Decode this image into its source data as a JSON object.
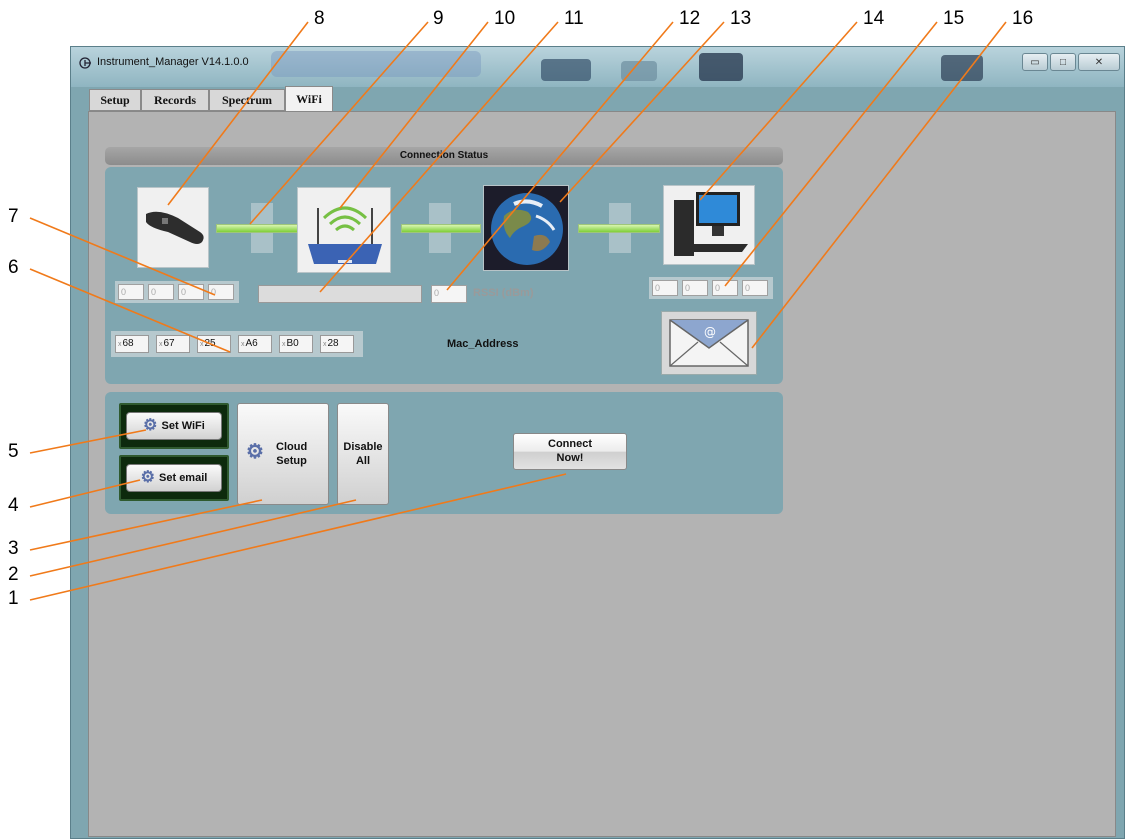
{
  "window": {
    "title": "Instrument_Manager V14.1.0.0",
    "controls": {
      "minimize": "▭",
      "maximize": "□",
      "close": "✕"
    }
  },
  "tabs": [
    {
      "label": "Setup"
    },
    {
      "label": "Records"
    },
    {
      "label": "Spectrum"
    },
    {
      "label": "WiFi",
      "active": true
    }
  ],
  "connection": {
    "header": "Connection Status",
    "instrument_ip": [
      "0",
      "0",
      "0",
      "0"
    ],
    "ssid": "",
    "rssi_value": "0",
    "rssi_label": "RSSI (dBm)",
    "pc_ip": [
      "0",
      "0",
      "0",
      "0"
    ],
    "mac_prefix": "x",
    "mac_address": [
      "68",
      "67",
      "25",
      "A6",
      "B0",
      "28"
    ],
    "mac_label": "Mac_Address",
    "link_color": "#7fcf3a"
  },
  "controls": {
    "set_wifi": "Set WiFi",
    "set_email": "Set email",
    "cloud_setup_line1": "Cloud",
    "cloud_setup_line2": "Setup",
    "disable_all_line1": "Disable",
    "disable_all_line2": "All",
    "connect_line1": "Connect",
    "connect_line2": "Now!"
  },
  "callouts": {
    "top": [
      "8",
      "9",
      "10",
      "11",
      "12",
      "13",
      "14",
      "15",
      "16"
    ],
    "left": [
      "7",
      "6",
      "5",
      "4",
      "3",
      "2",
      "1"
    ],
    "line_color": "#f07a1a"
  }
}
